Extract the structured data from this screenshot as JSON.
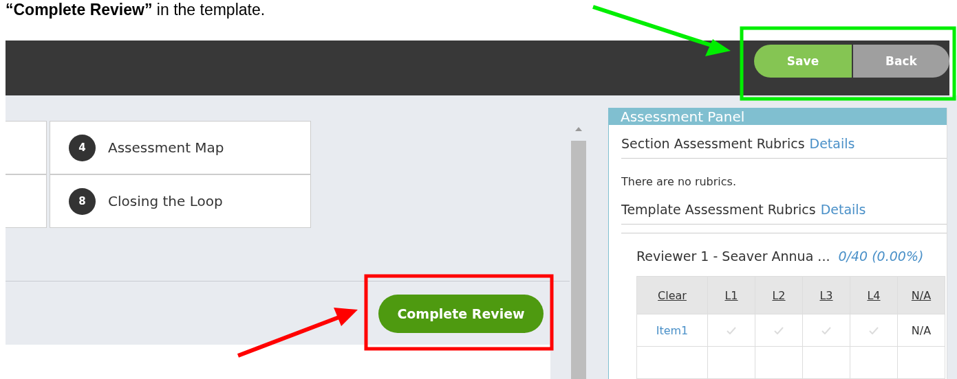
{
  "caption": "**“Complete Review”** in the template.",
  "header_buttons": [
    {
      "label": "Save",
      "kind": "primary"
    },
    {
      "label": "Back",
      "kind": "secondary"
    }
  ],
  "steps": [
    {
      "number": "4",
      "label": "Assessment Map"
    },
    {
      "number": "8",
      "label": "Closing the Loop"
    }
  ],
  "complete_button": "Complete Review",
  "panel": {
    "title": "Assessment Panel",
    "section_rubrics": {
      "label": "Section Assessment Rubrics",
      "link": "Details",
      "message": "There are no rubrics."
    },
    "template_rubrics": {
      "label": "Template Assessment Rubrics",
      "link": "Details"
    },
    "reviewer": {
      "name": "Reviewer 1 - Seaver Annua ...",
      "score": "0/40 (0.00%)"
    },
    "table": {
      "columns": [
        "Clear",
        "L1",
        "L2",
        "L3",
        "L4",
        "N/A"
      ],
      "rows": [
        {
          "item": "Item1",
          "levels": [
            {
              "checked": false
            },
            {
              "checked": false
            },
            {
              "checked": false
            },
            {
              "checked": false
            }
          ],
          "na": "N/A"
        }
      ]
    }
  }
}
